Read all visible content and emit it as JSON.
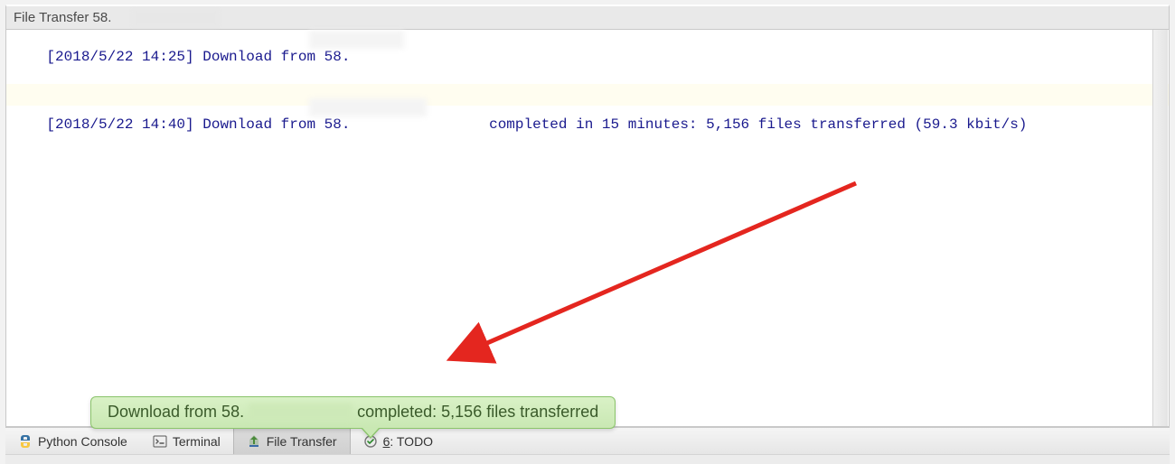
{
  "panel": {
    "title": "File Transfer 58."
  },
  "log": {
    "lines": [
      {
        "ts": "[2018/5/22 14:25]",
        "msg": " Download from 58."
      },
      {
        "ts": "[2018/5/22 14:40]",
        "msg": " Download from 58.                completed in 15 minutes: 5,156 files transferred (59.3 kbit/s)"
      }
    ]
  },
  "notification": {
    "prefix": "Download from 58.",
    "suffix": " completed: 5,156 files transferred"
  },
  "toolbar": {
    "python": "Python Console",
    "terminal": "Terminal",
    "file_transfer": "File Transfer",
    "todo_num": "6",
    "todo_label": ": TODO"
  }
}
